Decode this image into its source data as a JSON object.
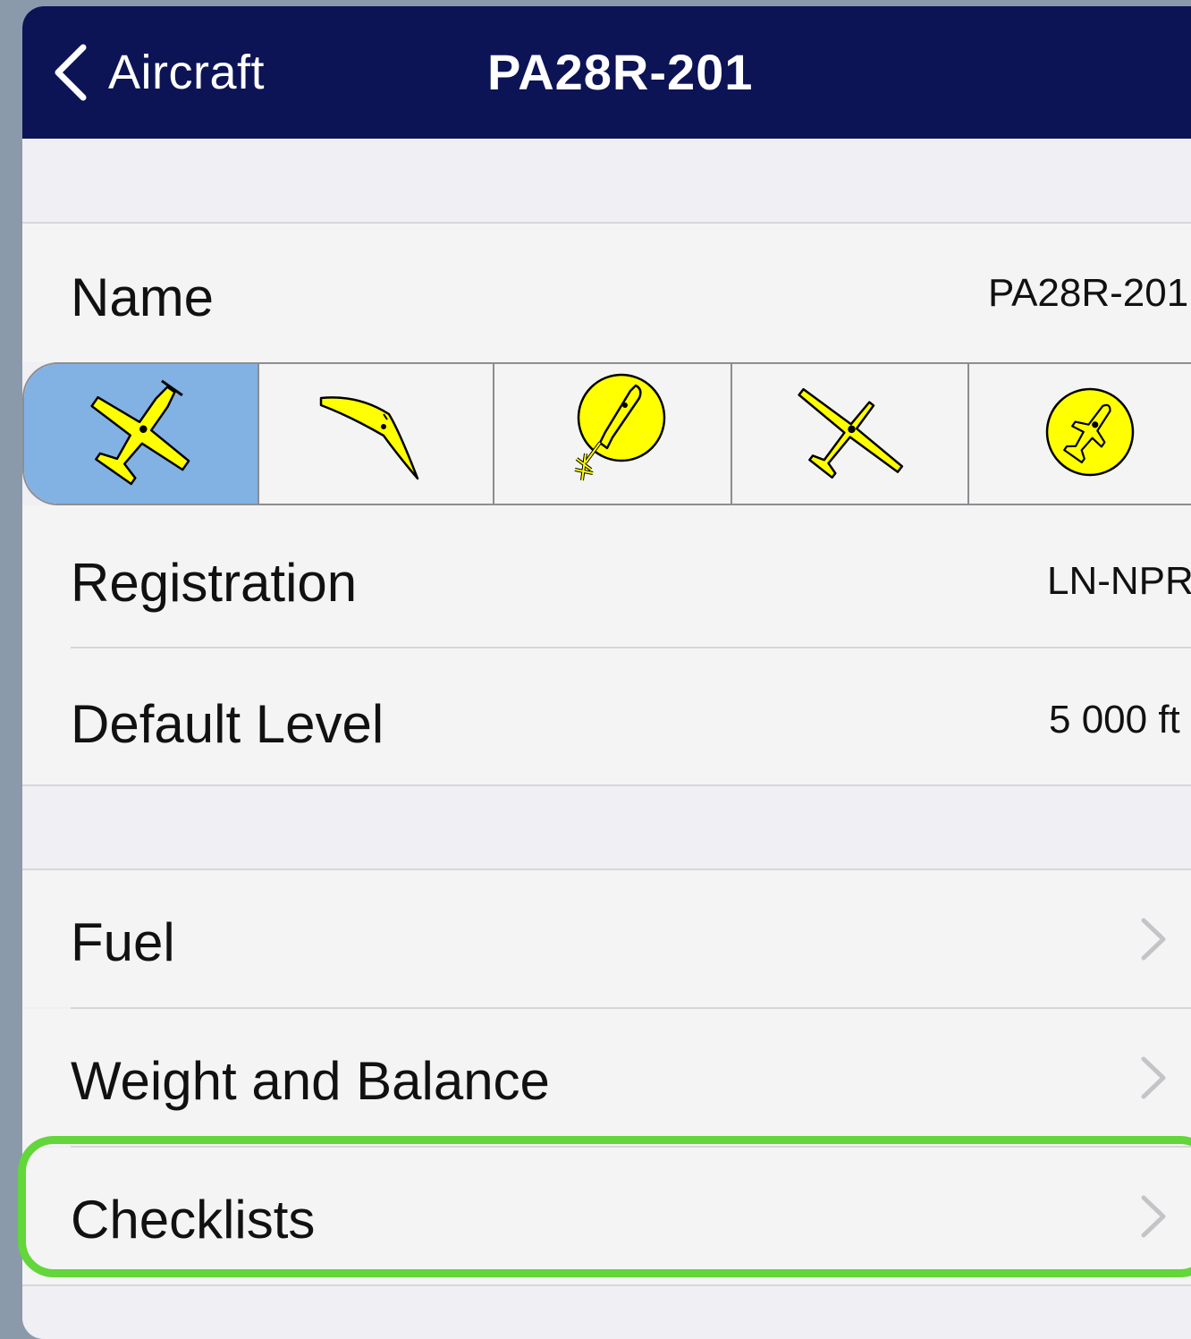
{
  "navbar": {
    "back_label": "Aircraft",
    "title": "PA28R-201",
    "background": "#0c1456"
  },
  "form": {
    "name": {
      "label": "Name",
      "value": "PA28R-201"
    },
    "aircraft_types": [
      {
        "icon": "airplane-icon",
        "selected": true
      },
      {
        "icon": "hang-glider-icon",
        "selected": false
      },
      {
        "icon": "balloon-icon",
        "selected": false
      },
      {
        "icon": "glider-icon",
        "selected": false
      },
      {
        "icon": "helicopter-icon",
        "selected": false
      }
    ],
    "registration": {
      "label": "Registration",
      "value": "LN-NPR"
    },
    "default_level": {
      "label": "Default Level",
      "value": "5 000 ft"
    }
  },
  "menu": {
    "fuel": {
      "label": "Fuel"
    },
    "weight_balance": {
      "label": "Weight and Balance"
    },
    "checklists": {
      "label": "Checklists"
    }
  },
  "colors": {
    "selected_segment": "#82b1e4",
    "icon_fill": "#ffff00",
    "highlight": "#62d63a"
  }
}
